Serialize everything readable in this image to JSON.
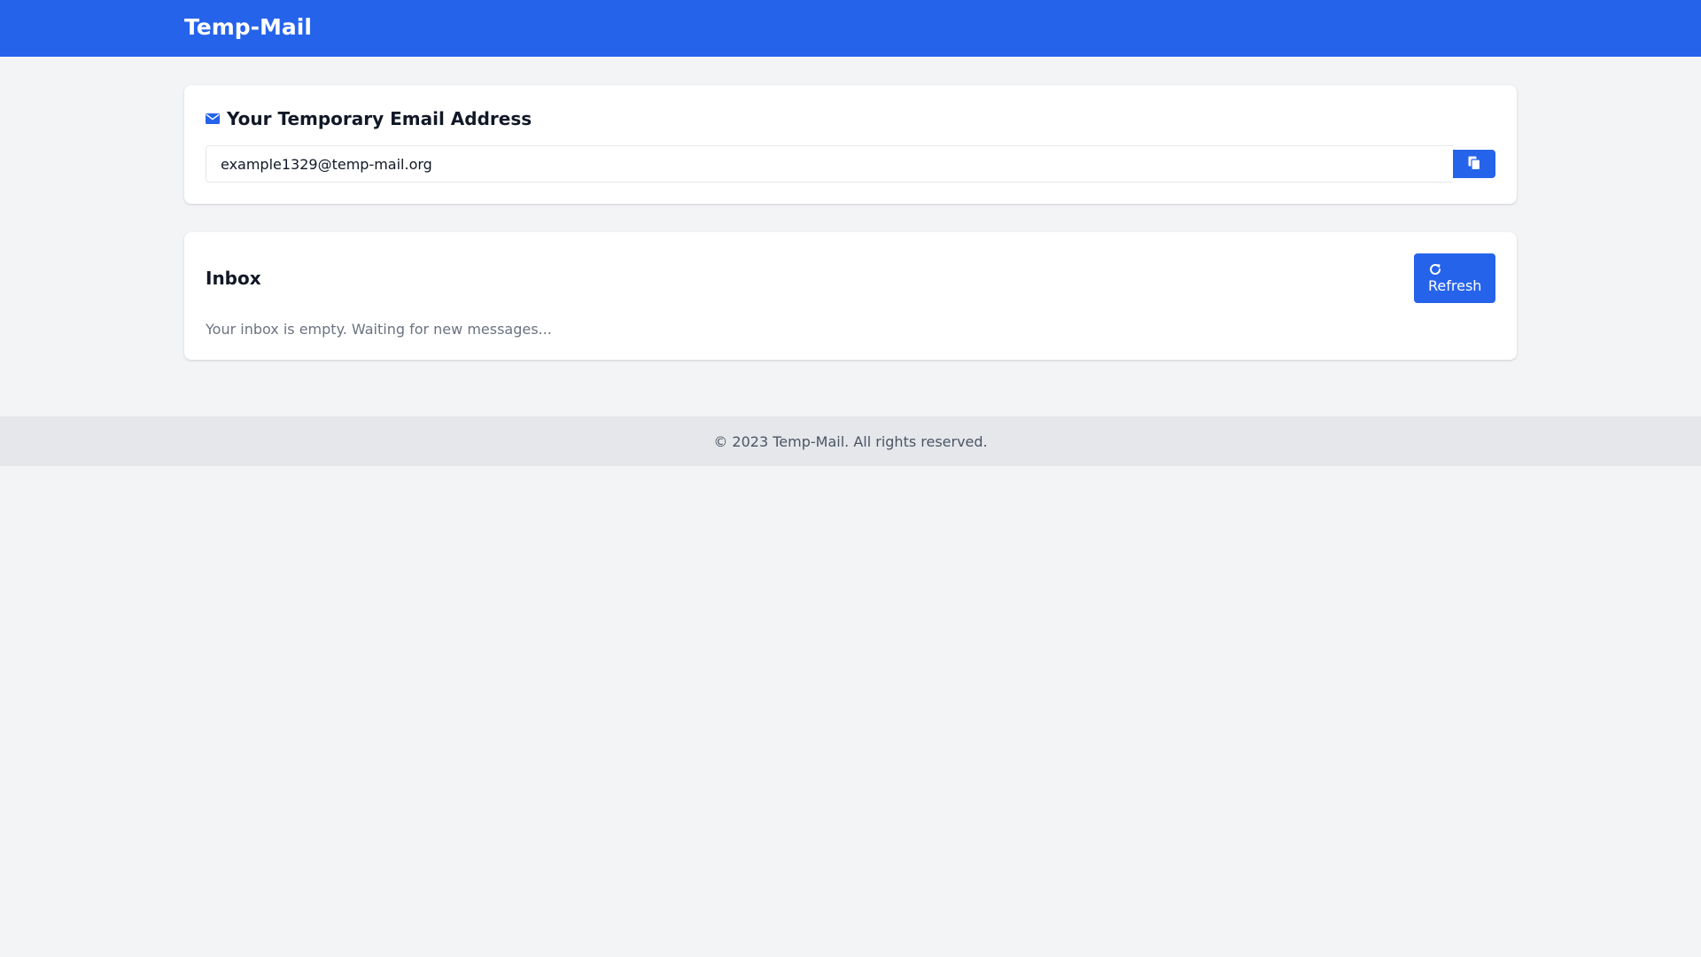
{
  "header": {
    "brand": "Temp-Mail"
  },
  "email_card": {
    "title": "Your Temporary Email Address",
    "title_icon": "envelope-icon",
    "email_value": "example1329@temp-mail.org",
    "copy_icon": "copy-icon"
  },
  "inbox": {
    "title": "Inbox",
    "refresh_label": "Refresh",
    "refresh_icon": "refresh-icon",
    "empty_message": "Your inbox is empty. Waiting for new messages..."
  },
  "footer": {
    "text": "© 2023 Temp-Mail. All rights reserved."
  },
  "colors": {
    "primary": "#2563eb",
    "background": "#f3f4f6",
    "footer_bg": "#e5e7eb",
    "muted_text": "#6b7280"
  }
}
